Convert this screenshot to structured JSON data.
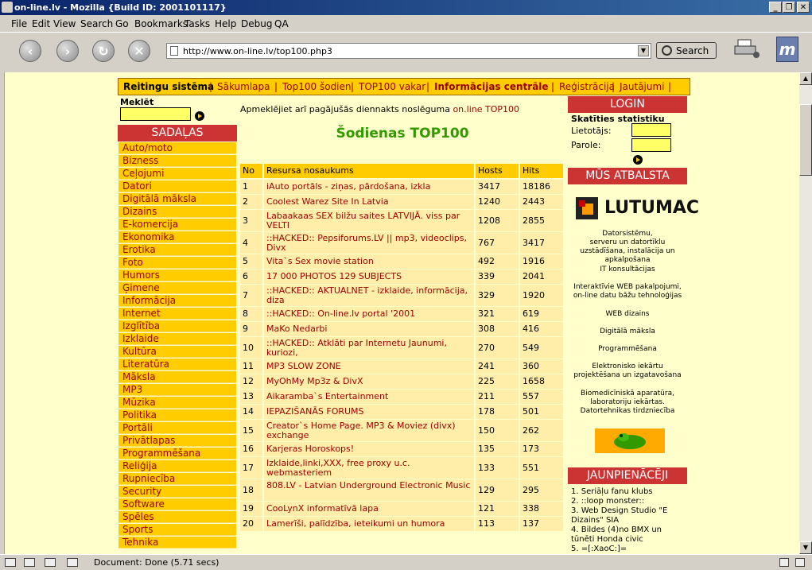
{
  "window": {
    "title": "on-line.lv - Mozilla {Build ID: 2001101117}"
  },
  "menu": [
    "File",
    "Edit",
    "View",
    "Search",
    "Go",
    "Bookmarks",
    "Tasks",
    "Help",
    "Debug",
    "QA"
  ],
  "navbar": {
    "url": "http://www.on-line.lv/top100.php3",
    "search_label": "Search"
  },
  "status": {
    "text": "Document: Done (5.71 secs)"
  },
  "page": {
    "topnav": [
      "Reitingu sistēma",
      "|",
      "Sākumlapa",
      "|",
      "Top100 šodien",
      "|",
      "TOP100 vakar",
      "|",
      "Informācijas centrāle",
      "|",
      "Reģistrācija",
      "|",
      "Jautājumi",
      "|"
    ],
    "search_label": "Meklēt",
    "sections_title": "SADAĻAS",
    "categories": [
      "Auto/moto",
      "Bizness",
      "Ceļojumi",
      "Datori",
      "Digitālā māksla",
      "Dizains",
      "E-komercija",
      "Ekonomika",
      "Erotika",
      "Foto",
      "Humors",
      "Ģimene",
      "Informācija",
      "Internet",
      "Izglītība",
      "Izklaide",
      "Kultūra",
      "Literatūra",
      "Māksla",
      "MP3",
      "Mūzika",
      "Politika",
      "Portāli",
      "Privātlapas",
      "Programmēšana",
      "Reliģija",
      "Rupniecība",
      "Security",
      "Software",
      "Spēles",
      "Sports",
      "Tehnika"
    ],
    "intro_text": "Apmeklējiet arī pagājušās diennakts noslēguma ",
    "intro_link": "on.line TOP100",
    "heading": "Šodienas TOP100",
    "table_headers": [
      "No",
      "Resursa nosaukums",
      "Hosts",
      "Hits"
    ],
    "rows": [
      {
        "no": "1",
        "name": "iAuto portāls - ziņas, pārdošana, izkla",
        "hosts": "3417",
        "hits": "18186"
      },
      {
        "no": "2",
        "name": "Coolest Warez Site In Latvia",
        "hosts": "1240",
        "hits": "2443"
      },
      {
        "no": "3",
        "name": "Labaakaas SEX bilžu saites LATVIJĀ. viss par VELTI",
        "hosts": "1208",
        "hits": "2855"
      },
      {
        "no": "4",
        "name": "::HACKED:: Pepsiforums.LV || mp3, videoclips, Divx",
        "hosts": "767",
        "hits": "3417"
      },
      {
        "no": "5",
        "name": "Vita`s Sex movie station",
        "hosts": "492",
        "hits": "1916"
      },
      {
        "no": "6",
        "name": "17 000 PHOTOS 129 SUBJECTS",
        "hosts": "339",
        "hits": "2041"
      },
      {
        "no": "7",
        "name": "::HACKED:: AKTUALNET - izklaide, informācija, diza",
        "hosts": "329",
        "hits": "1920"
      },
      {
        "no": "8",
        "name": "::HACKED:: On-line.lv portal '2001",
        "hosts": "321",
        "hits": "619"
      },
      {
        "no": "9",
        "name": "MaKo Nedarbi",
        "hosts": "308",
        "hits": "416"
      },
      {
        "no": "10",
        "name": "::HACKED:: Atklāti par Internetu Jaunumi, kuriozi,",
        "hosts": "270",
        "hits": "549"
      },
      {
        "no": "11",
        "name": "MP3 SLOW ZONE",
        "hosts": "241",
        "hits": "360"
      },
      {
        "no": "12",
        "name": "MyOhMy Mp3z & DivX",
        "hosts": "225",
        "hits": "1658"
      },
      {
        "no": "13",
        "name": "Aikaramba`s Entertainment",
        "hosts": "211",
        "hits": "557"
      },
      {
        "no": "14",
        "name": "IEPAZIŠANĀS FORUMS",
        "hosts": "178",
        "hits": "501"
      },
      {
        "no": "15",
        "name": "Creator`s Home Page. MP3 & Moviez (divx) exchange",
        "hosts": "150",
        "hits": "262"
      },
      {
        "no": "16",
        "name": "Karjeras Horoskops!",
        "hosts": "135",
        "hits": "173"
      },
      {
        "no": "17",
        "name": "Izklaide,linki,XXX, free proxy u.c. webmasteriem",
        "hosts": "133",
        "hits": "551"
      },
      {
        "no": "18",
        "name": "808.LV - Latvian Underground Electronic Music",
        "hosts": "129",
        "hits": "295"
      },
      {
        "no": "19",
        "name": "CooLynX informatīvā lapa",
        "hosts": "121",
        "hits": "338"
      },
      {
        "no": "20",
        "name": "Lamerīši, palīdzība, ieteikumi un humora",
        "hosts": "113",
        "hits": "137"
      }
    ],
    "login": {
      "title": "LOGIN",
      "subtitle": "Skatīties statistiku",
      "user_label": "Lietotājs:",
      "pass_label": "Parole:"
    },
    "support": {
      "title": "MŪS ATBALSTA",
      "logo_text": "LUTUMAC",
      "blocks": [
        "Datorsistēmu,",
        "serveru un datortīklu uzstādīšana, instalācija un apkalpošana",
        "IT konsultācijas",
        "Interaktīvie WEB pakalpojumi, on-line datu bāžu tehnoloģijas",
        "WEB dizains",
        "Digitālā māksla",
        "Programmēšana",
        "Elektronisko iekārtu projektēšana un izgatavošana",
        "Biomedicīniskā aparatūra, laboratoriju iekārtas. Datortehnikas tirdzniecība"
      ]
    },
    "newcomers": {
      "title": "JAUNPIENĀCĒJI",
      "items": [
        "1. Seriāļu fanu klubs",
        "2. ::loop monster::",
        "3. Web Design Studio \"E Dizains\" SIA",
        "4. Bildes (4)no BMX un tūnēti Honda civic",
        "5. =[:XaoC:]="
      ]
    }
  }
}
